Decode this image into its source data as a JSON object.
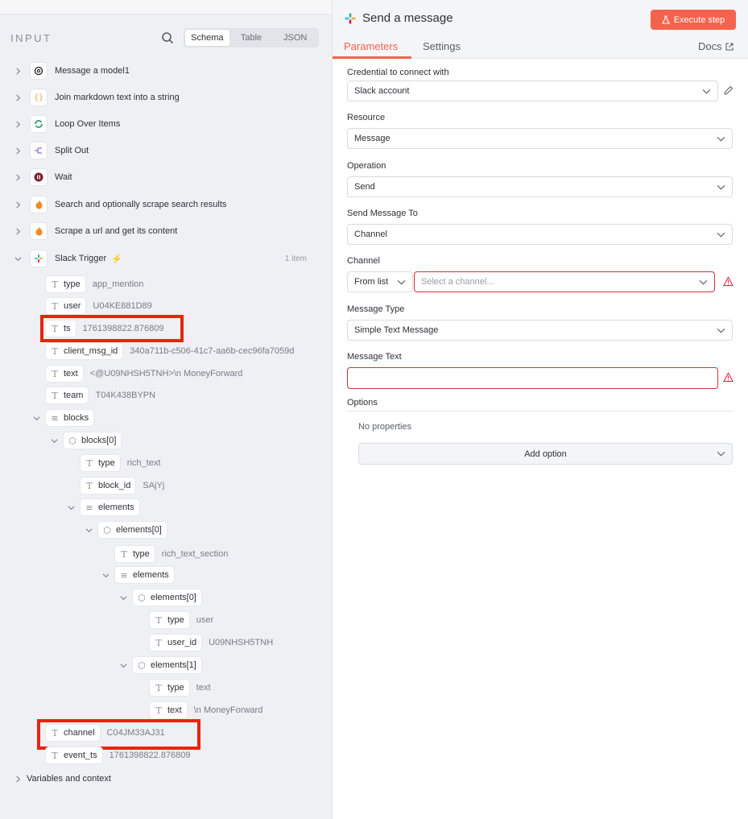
{
  "input_panel": {
    "title": "INPUT",
    "view_tabs": [
      "Schema",
      "Table",
      "JSON"
    ],
    "nodes": [
      {
        "name": "Message a model1",
        "icon": "openai-icon"
      },
      {
        "name": "Join markdown text into a string",
        "icon": "braces-icon"
      },
      {
        "name": "Loop Over Items",
        "icon": "loop-icon"
      },
      {
        "name": "Split Out",
        "icon": "split-icon"
      },
      {
        "name": "Wait",
        "icon": "pause-icon"
      },
      {
        "name": "Search and optionally scrape search results",
        "icon": "fire-icon"
      },
      {
        "name": "Scrape a url and get its content",
        "icon": "fire-icon"
      },
      {
        "name": "Slack Trigger",
        "icon": "slack-icon",
        "count": "1 item"
      }
    ],
    "fields": {
      "type": {
        "key": "type",
        "value": "app_mention"
      },
      "user": {
        "key": "user",
        "value": "U04KE881D89"
      },
      "ts": {
        "key": "ts",
        "value": "1761398822.876809"
      },
      "client_msg_id": {
        "key": "client_msg_id",
        "value": "340a711b-c506-41c7-aa6b-cec96fa7059d"
      },
      "text": {
        "key": "text",
        "value": "<@U09NHSH5TNH>\\n MoneyForward"
      },
      "team": {
        "key": "team",
        "value": "T04K438BYPN"
      },
      "blocks": {
        "key": "blocks"
      },
      "blocks0": {
        "key": "blocks[0]"
      },
      "b_type": {
        "key": "type",
        "value": "rich_text"
      },
      "b_block_id": {
        "key": "block_id",
        "value": "SAjYj"
      },
      "b_elements": {
        "key": "elements"
      },
      "e0": {
        "key": "elements[0]"
      },
      "e0_type": {
        "key": "type",
        "value": "rich_text_section"
      },
      "e0_elements": {
        "key": "elements"
      },
      "ee0": {
        "key": "elements[0]"
      },
      "ee0_type": {
        "key": "type",
        "value": "user"
      },
      "ee0_user_id": {
        "key": "user_id",
        "value": "U09NHSH5TNH"
      },
      "ee1": {
        "key": "elements[1]"
      },
      "ee1_type": {
        "key": "type",
        "value": "text"
      },
      "ee1_text": {
        "key": "text",
        "value": "\\n MoneyForward"
      },
      "channel": {
        "key": "channel",
        "value": "C04JM33AJ31"
      },
      "event_ts": {
        "key": "event_ts",
        "value": "1761398822.876809"
      }
    },
    "variables_label": "Variables and context"
  },
  "node_panel": {
    "title": "Send a message",
    "execute_label": "Execute step",
    "tabs": [
      "Parameters",
      "Settings"
    ],
    "docs_label": "Docs",
    "credential": {
      "label": "Credential to connect with",
      "value": "Slack account"
    },
    "resource": {
      "label": "Resource",
      "value": "Message"
    },
    "operation": {
      "label": "Operation",
      "value": "Send"
    },
    "send_to": {
      "label": "Send Message To",
      "value": "Channel"
    },
    "channel": {
      "label": "Channel",
      "mode": "From list",
      "placeholder": "Select a channel..."
    },
    "message_type": {
      "label": "Message Type",
      "value": "Simple Text Message"
    },
    "message_text": {
      "label": "Message Text",
      "value": ""
    },
    "options": {
      "label": "Options",
      "empty": "No properties",
      "add_label": "Add option"
    }
  },
  "colors": {
    "accent": "#f5624d",
    "error": "#d3313a",
    "highlight": "#e8240f"
  }
}
